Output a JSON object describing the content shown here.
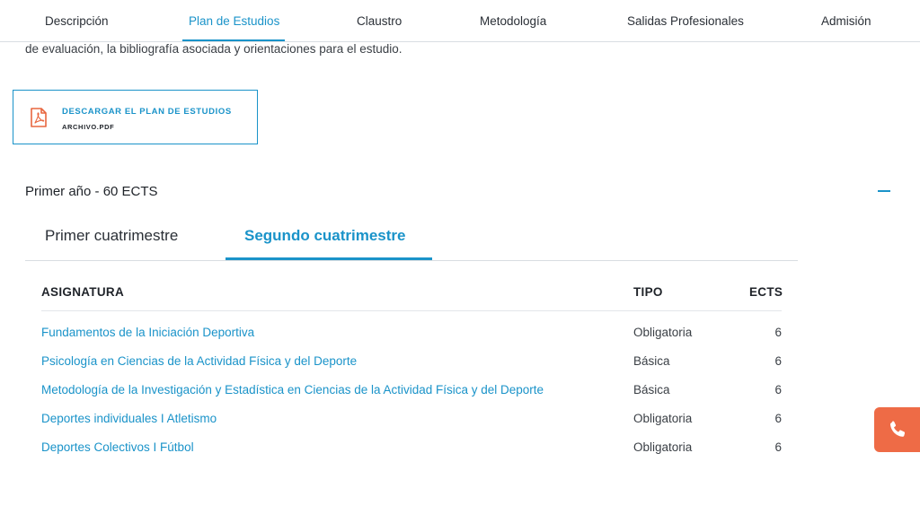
{
  "nav": {
    "items": [
      {
        "label": "Descripción"
      },
      {
        "label": "Plan de Estudios"
      },
      {
        "label": "Claustro"
      },
      {
        "label": "Metodología"
      },
      {
        "label": "Salidas Profesionales"
      },
      {
        "label": "Admisión"
      }
    ],
    "active": "Plan de Estudios"
  },
  "intro_text": "de evaluación, la bibliografía asociada y orientaciones para el estudio.",
  "download": {
    "title": "DESCARGAR EL PLAN DE ESTUDIOS",
    "file": "ARCHIVO.PDF",
    "icon": "pdf-file-icon"
  },
  "year": {
    "title": "Primer año - 60 ECTS",
    "toggle_icon": "minus-icon"
  },
  "tabs": [
    {
      "label": "Primer cuatrimestre"
    },
    {
      "label": "Segundo cuatrimestre"
    }
  ],
  "active_tab": "Segundo cuatrimestre",
  "table": {
    "headers": {
      "asignatura": "ASIGNATURA",
      "tipo": "TIPO",
      "ects": "ECTS"
    },
    "rows": [
      {
        "name": "Fundamentos de la Iniciación Deportiva",
        "tipo": "Obligatoria",
        "ects": "6"
      },
      {
        "name": "Psicología en Ciencias de la Actividad Física y del Deporte",
        "tipo": "Básica",
        "ects": "6"
      },
      {
        "name": "Metodología de la Investigación y Estadística en Ciencias de la Actividad Física y del Deporte",
        "tipo": "Básica",
        "ects": "6"
      },
      {
        "name": "Deportes individuales I Atletismo",
        "tipo": "Obligatoria",
        "ects": "6"
      },
      {
        "name": "Deportes Colectivos I Fútbol",
        "tipo": "Obligatoria",
        "ects": "6"
      }
    ]
  },
  "colors": {
    "accent": "#1a93c9",
    "phone_button": "#ee6b46",
    "pdf_icon": "#e8663f"
  },
  "phone_icon": "phone-icon"
}
